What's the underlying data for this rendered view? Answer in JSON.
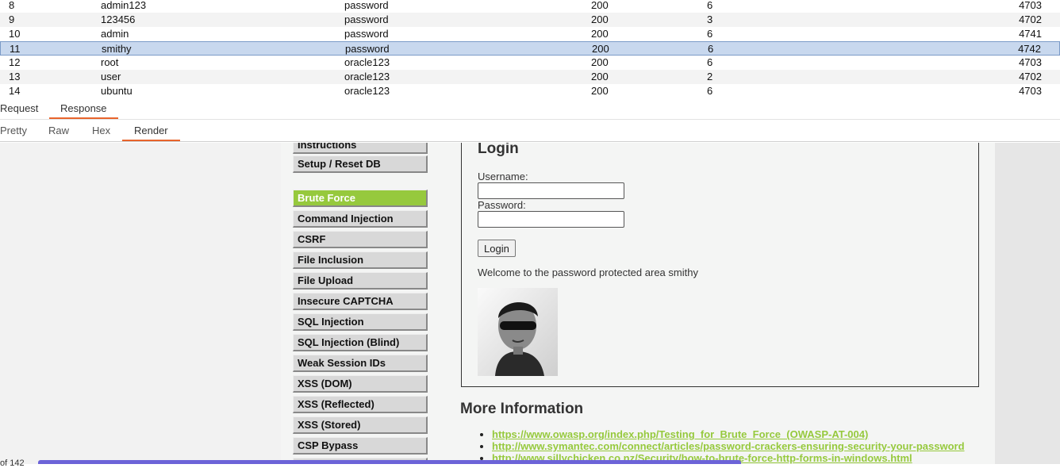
{
  "results": {
    "rows": [
      {
        "num": "8",
        "payload1": "admin123",
        "payload2": "password",
        "status": "200",
        "error": "6",
        "length": "4703",
        "selected": false
      },
      {
        "num": "9",
        "payload1": "123456",
        "payload2": "password",
        "status": "200",
        "error": "3",
        "length": "4702",
        "selected": false
      },
      {
        "num": "10",
        "payload1": "admin",
        "payload2": "password",
        "status": "200",
        "error": "6",
        "length": "4741",
        "selected": false
      },
      {
        "num": "11",
        "payload1": "smithy",
        "payload2": "password",
        "status": "200",
        "error": "6",
        "length": "4742",
        "selected": true
      },
      {
        "num": "12",
        "payload1": "root",
        "payload2": "oracle123",
        "status": "200",
        "error": "6",
        "length": "4703",
        "selected": false
      },
      {
        "num": "13",
        "payload1": "user",
        "payload2": "oracle123",
        "status": "200",
        "error": "2",
        "length": "4702",
        "selected": false
      },
      {
        "num": "14",
        "payload1": "ubuntu",
        "payload2": "oracle123",
        "status": "200",
        "error": "6",
        "length": "4703",
        "selected": false
      }
    ]
  },
  "tabs": {
    "request": "Request",
    "response": "Response"
  },
  "view_tabs": {
    "pretty": "Pretty",
    "raw": "Raw",
    "hex": "Hex",
    "render": "Render"
  },
  "menu": {
    "items": [
      "Instructions",
      "Setup / Reset DB",
      "Brute Force",
      "Command Injection",
      "CSRF",
      "File Inclusion",
      "File Upload",
      "Insecure CAPTCHA",
      "SQL Injection",
      "SQL Injection (Blind)",
      "Weak Session IDs",
      "XSS (DOM)",
      "XSS (Reflected)",
      "XSS (Stored)",
      "CSP Bypass",
      ""
    ],
    "active": "Brute Force"
  },
  "login": {
    "title": "Login",
    "username_label": "Username:",
    "password_label": "Password:",
    "button": "Login",
    "welcome": "Welcome to the password protected area smithy"
  },
  "more_info": {
    "title": "More Information",
    "links": [
      "https://www.owasp.org/index.php/Testing_for_Brute_Force_(OWASP-AT-004)",
      "http://www.symantec.com/connect/articles/password-crackers-ensuring-security-your-password",
      "http://www.sillychicken.co.nz/Security/how-to-brute-force-http-forms-in-windows.html"
    ]
  },
  "footer": {
    "count_text": "of 142"
  },
  "colors": {
    "accent": "#e8642c",
    "dvwa_green": "#96c93d",
    "progress": "#6c63d8",
    "selected_row": "#c8d8ee"
  }
}
